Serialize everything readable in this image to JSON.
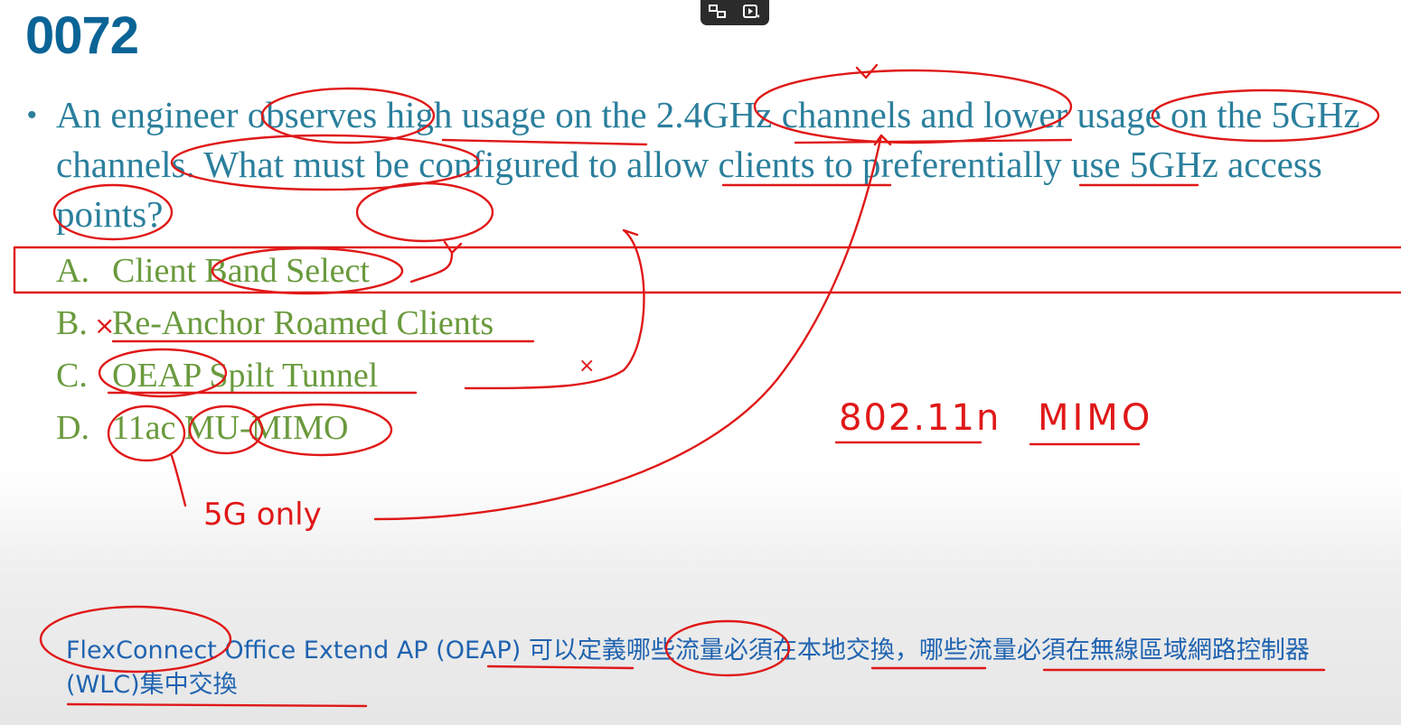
{
  "slide": {
    "title": "0072",
    "question": "An engineer observes high usage on the 2.4GHz channels and lower usage on the 5GHz channels. What must be configured to allow clients to preferentially use 5GHz access points?",
    "options": [
      {
        "letter": "A.",
        "text": "Client Band Select"
      },
      {
        "letter": "B.",
        "text": "Re-Anchor Roamed Clients"
      },
      {
        "letter": "C.",
        "text": "OEAP Spilt Tunnel"
      },
      {
        "letter": "D.",
        "text": "11ac MU-MIMO"
      }
    ],
    "note": "FlexConnect Office Extend AP (OEAP) 可以定義哪些流量必須在本地交換，哪些流量必須在無線區域網路控制器(WLC)集中交換"
  },
  "handwriting": {
    "band_note": "802.11n",
    "mimo_note": "MIMO",
    "fiveg_note": "5G only",
    "cross_mark": "×",
    "cross_mark_b": "×"
  },
  "player_icons": [
    "pip-icon",
    "video-sparkle-icon"
  ],
  "colors": {
    "title": "#0b6496",
    "question": "#2a7f9c",
    "options": "#6a9a3d",
    "note": "#1f63b0",
    "annotation": "#e01818"
  }
}
